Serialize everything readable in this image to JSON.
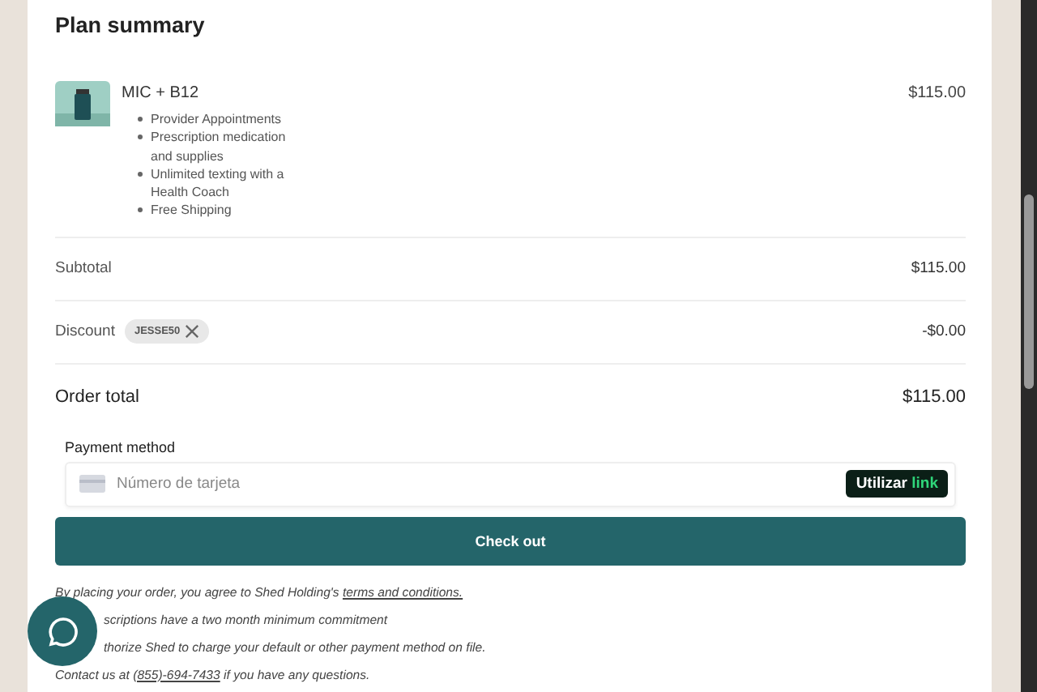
{
  "title": "Plan summary",
  "product": {
    "name": "MIC + B12",
    "price": "$115.00",
    "features": [
      "Provider Appointments",
      "Prescription medication and supplies",
      "Unlimited texting with a Health Coach",
      "Free Shipping"
    ]
  },
  "subtotal": {
    "label": "Subtotal",
    "value": "$115.00"
  },
  "discount": {
    "label": "Discount",
    "code": "JESSE50",
    "value": "-$0.00"
  },
  "total": {
    "label": "Order total",
    "value": "$115.00"
  },
  "payment": {
    "label": "Payment method",
    "placeholder": "Número de tarjeta",
    "link_button": {
      "prefix": "Utilizar",
      "brand": "link"
    }
  },
  "checkout_button": "Check out",
  "legal": [
    {
      "before": "By placing your order, you agree to Shed Holding's ",
      "link": "terms and conditions.",
      "covered": false
    },
    {
      "before": "scriptions have a two month minimum commitment",
      "covered": true
    },
    {
      "before": "thorize Shed to charge your default or other payment method on file.",
      "covered": true
    },
    {
      "before": "Contact us at ",
      "link": "(855)-694-7433",
      "after": " if you have any questions.",
      "covered": false
    }
  ]
}
